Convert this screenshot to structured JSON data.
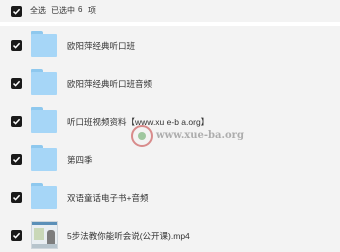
{
  "header": {
    "select_all": "全选",
    "selected_label": "已选中",
    "selected_count": "6",
    "unit": "项"
  },
  "items": [
    {
      "name": "欧阳萍经典听口班",
      "type": "folder"
    },
    {
      "name": "欧阳萍经典听口班音频",
      "type": "folder"
    },
    {
      "name": "听口班视频资料【www.xu e-b a.org】",
      "type": "folder"
    },
    {
      "name": "第四季",
      "type": "folder"
    },
    {
      "name": "双语童话电子书+音频",
      "type": "folder"
    },
    {
      "name": "5步法教你能听会说(公开课).mp4",
      "type": "video"
    }
  ],
  "watermark": {
    "text": "www.xue-ba.org"
  }
}
